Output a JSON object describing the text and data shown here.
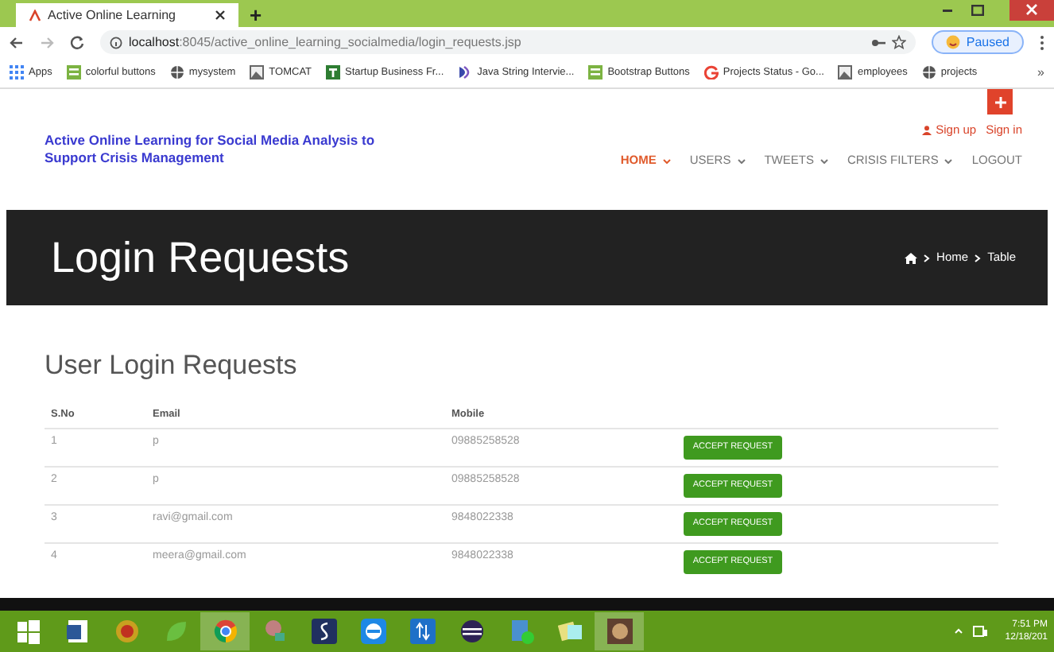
{
  "browser": {
    "tab_title": "Active Online Learning",
    "new_tab": "+",
    "url_host": "localhost",
    "url_path": ":8045/active_online_learning_socialmedia/login_requests.jsp",
    "profile": "Paused",
    "more": "»"
  },
  "bookmarks": [
    {
      "label": "Apps",
      "kind": "apps"
    },
    {
      "label": "colorful buttons",
      "kind": "sheet"
    },
    {
      "label": "mysystem",
      "kind": "globe"
    },
    {
      "label": "TOMCAT",
      "kind": "image"
    },
    {
      "label": "Startup Business Fr...",
      "kind": "t"
    },
    {
      "label": "Java String Intervie...",
      "kind": "d"
    },
    {
      "label": "Bootstrap Buttons",
      "kind": "sheet"
    },
    {
      "label": "Projects Status - Go...",
      "kind": "g"
    },
    {
      "label": "employees",
      "kind": "image"
    },
    {
      "label": "projects",
      "kind": "globe"
    }
  ],
  "header": {
    "site_title": "Active Online Learning for Social Media Analysis to Support Crisis Management",
    "sign_up": "Sign up",
    "sign_in": "Sign in",
    "nav": [
      {
        "label": "HOME",
        "selected": true,
        "dropdown": true
      },
      {
        "label": "USERS",
        "selected": false,
        "dropdown": true
      },
      {
        "label": "TWEETS",
        "selected": false,
        "dropdown": true
      },
      {
        "label": "CRISIS FILTERS",
        "selected": false,
        "dropdown": true
      },
      {
        "label": "LOGOUT",
        "selected": false,
        "dropdown": false
      }
    ]
  },
  "banner": {
    "title": "Login Requests",
    "breadcrumbs": [
      "Home",
      "Table"
    ]
  },
  "table": {
    "heading": "User Login Requests",
    "columns": [
      "S.No",
      "Email",
      "Mobile"
    ],
    "rows": [
      {
        "cells": [
          "1",
          "p",
          "09885258528"
        ],
        "action": "ACCEPT REQUEST"
      },
      {
        "cells": [
          "2",
          "p",
          "09885258528"
        ],
        "action": "ACCEPT REQUEST"
      },
      {
        "cells": [
          "3",
          "ravi@gmail.com",
          "9848022338"
        ],
        "action": "ACCEPT REQUEST"
      },
      {
        "cells": [
          "4",
          "meera@gmail.com",
          "9848022338"
        ],
        "action": "ACCEPT REQUEST"
      }
    ]
  },
  "taskbar": {
    "apps": [
      {
        "kind": "start"
      },
      {
        "kind": "word",
        "color": "#2b5797"
      },
      {
        "kind": "hs",
        "color": "#c8a020"
      },
      {
        "kind": "leaf",
        "color": "#6abf40"
      },
      {
        "kind": "chrome",
        "color": "#f4b400",
        "selected": true
      },
      {
        "kind": "tool",
        "color": "#c08080"
      },
      {
        "kind": "eight",
        "color": "#203060"
      },
      {
        "kind": "remote",
        "color": "#1e88e5"
      },
      {
        "kind": "arrows",
        "color": "#1e70c8"
      },
      {
        "kind": "eclipse",
        "color": "#2c2255"
      },
      {
        "kind": "files",
        "color": "#4a90d0"
      },
      {
        "kind": "notes",
        "color": "#e8e080"
      },
      {
        "kind": "game",
        "color": "#604030",
        "selected": true
      }
    ],
    "time": "7:51 PM",
    "date": "12/18/201"
  }
}
